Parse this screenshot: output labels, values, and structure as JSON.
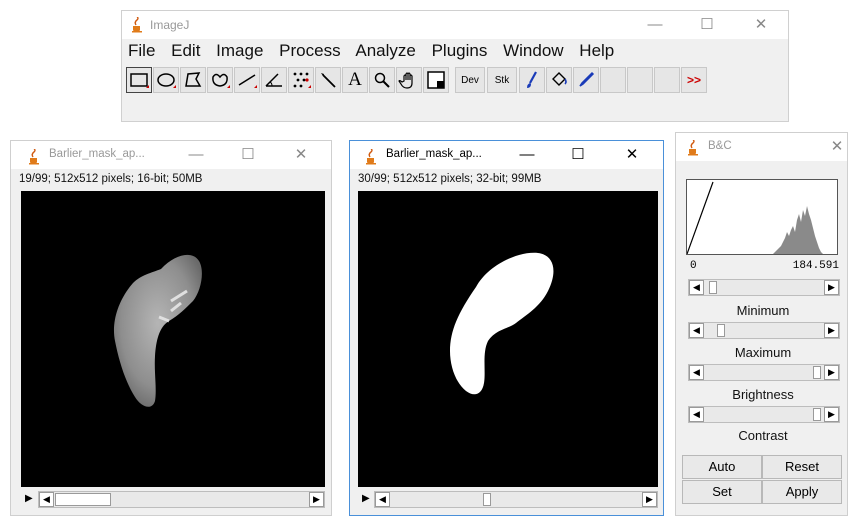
{
  "imagej": {
    "title": "ImageJ",
    "menu": [
      "File",
      "Edit",
      "Image",
      "Process",
      "Analyze",
      "Plugins",
      "Window",
      "Help"
    ],
    "tools": [
      "rectangle-tool",
      "oval-tool",
      "polygon-tool",
      "freehand-tool",
      "line-tool",
      "angle-tool",
      "multipoint-tool",
      "wand-tool",
      "text-tool",
      "magnifier-tool",
      "hand-tool",
      "color-picker-tool",
      "dev-menu",
      "stk-menu",
      "brush-tool",
      "flood-fill-tool",
      "pencil-tool",
      "more-tools"
    ],
    "dev_label": "Dev",
    "stk_label": "Stk",
    "more_label": ">>",
    "text_tool_label": "A"
  },
  "left_window": {
    "title": "Barlier_mask_ap...",
    "status": "19/99; 512x512 pixels; 16-bit; 50MB"
  },
  "right_window": {
    "title": "Barlier_mask_ap...",
    "status": "30/99; 512x512 pixels; 32-bit; 99MB"
  },
  "bc": {
    "title": "B&C",
    "min_value": "0",
    "max_value": "184.591",
    "minimum_label": "Minimum",
    "maximum_label": "Maximum",
    "brightness_label": "Brightness",
    "contrast_label": "Contrast",
    "auto_label": "Auto",
    "reset_label": "Reset",
    "set_label": "Set",
    "apply_label": "Apply",
    "minimum_level": 0.05,
    "maximum_level": 0.1,
    "brightness_level": 0.9,
    "contrast_level": 0.9
  },
  "window_controls": {
    "minimize": "—",
    "maximize": "☐",
    "close": "✕"
  }
}
